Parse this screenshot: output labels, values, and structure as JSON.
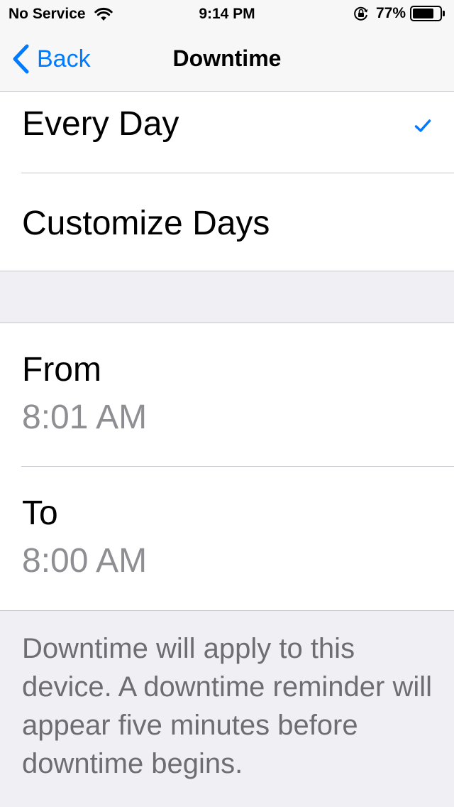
{
  "status_bar": {
    "carrier": "No Service",
    "time": "9:14 PM",
    "battery_percent": "77%",
    "icons": [
      "wifi-icon",
      "lock-rotation-icon",
      "battery-icon"
    ]
  },
  "nav": {
    "back_label": "Back",
    "title": "Downtime"
  },
  "days": {
    "options": [
      {
        "label": "Every Day",
        "selected": true
      },
      {
        "label": "Customize Days",
        "selected": false
      }
    ]
  },
  "schedule": {
    "from_label": "From",
    "from_value": "8:01 AM",
    "to_label": "To",
    "to_value": "8:00 AM"
  },
  "footer": {
    "note": "Downtime will apply to this device. A downtime reminder will appear five minutes before downtime begins."
  },
  "colors": {
    "accent": "#007aff",
    "secondary_text": "#8e8e93",
    "footer_text": "#6d6d72",
    "grouped_background": "#efeff4"
  }
}
